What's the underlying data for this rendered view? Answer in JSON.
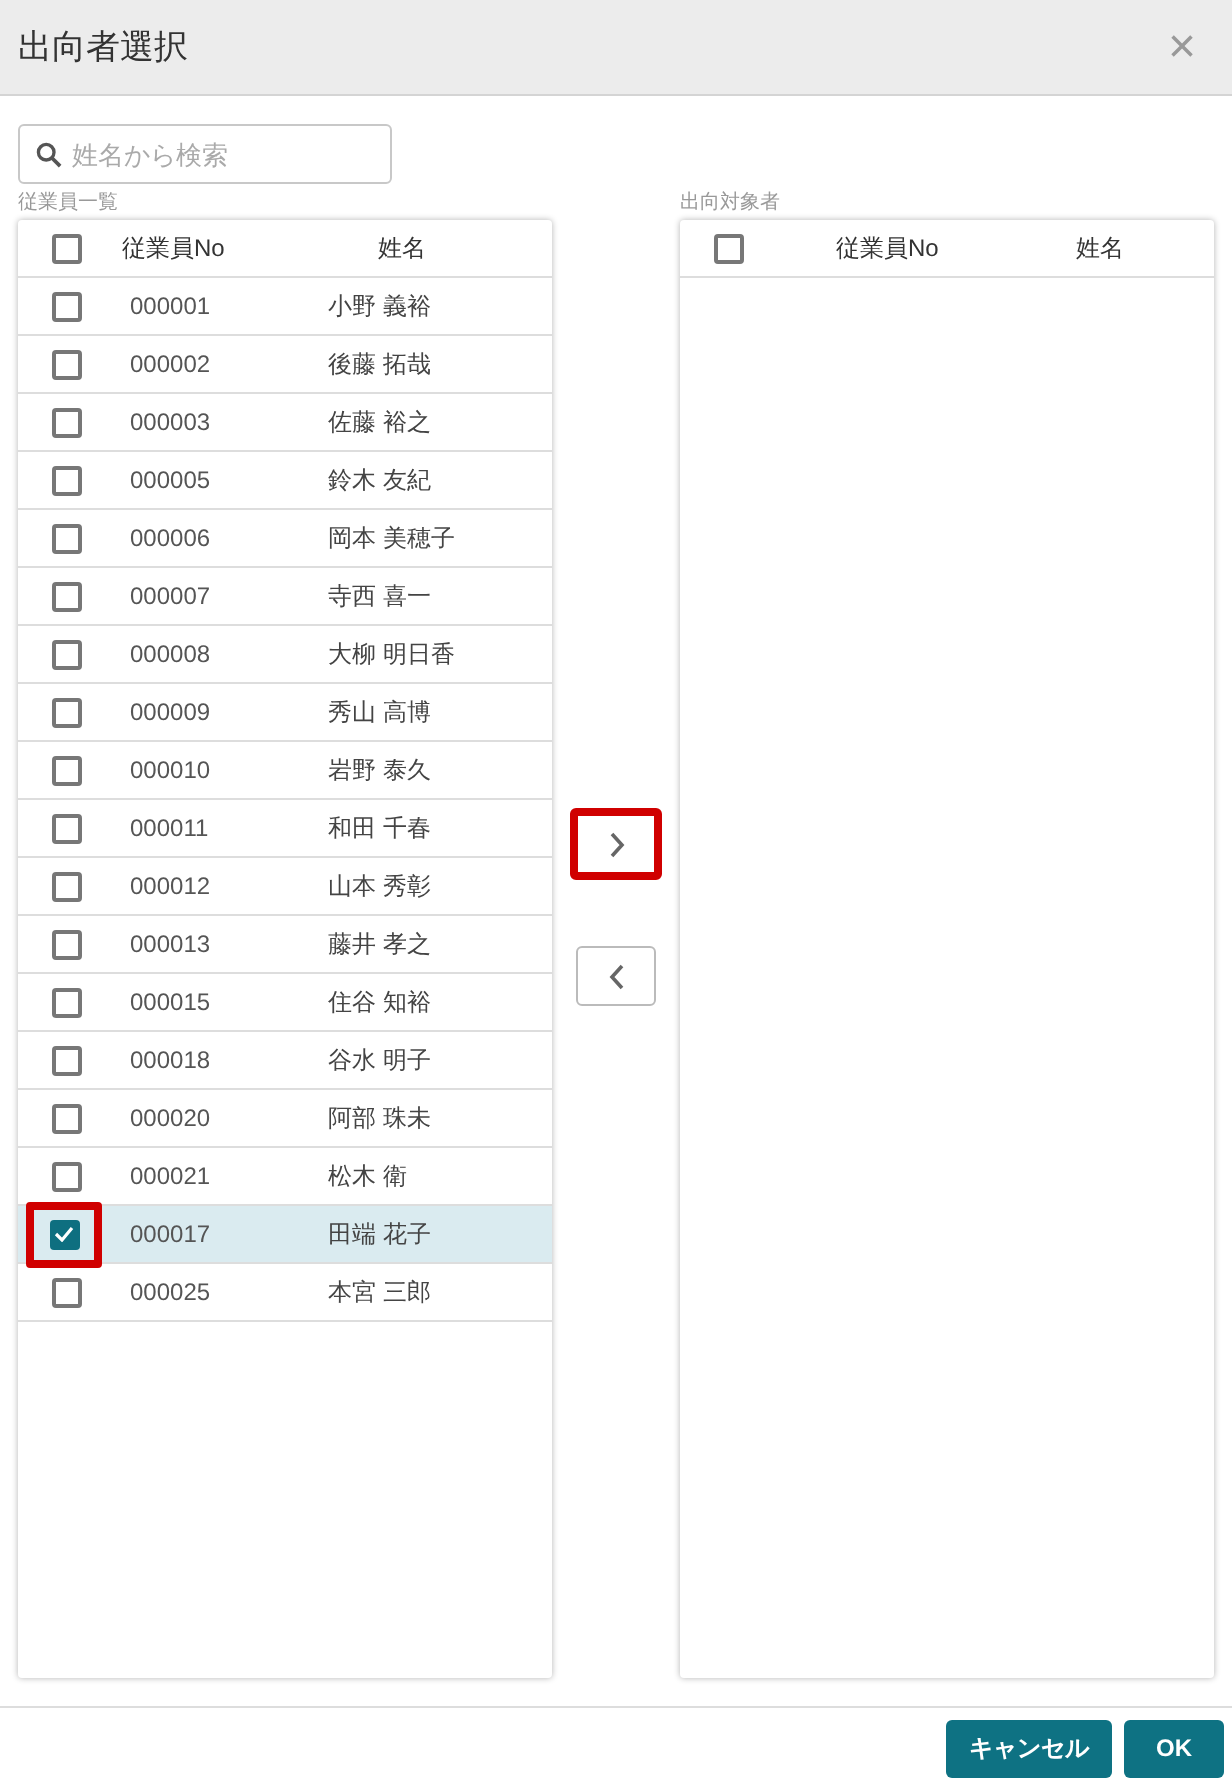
{
  "dialog": {
    "title": "出向者選択",
    "close": "×"
  },
  "search": {
    "placeholder": "姓名から検索"
  },
  "employee_list": {
    "label": "従業員一覧",
    "columns": [
      "従業員No",
      "姓名"
    ],
    "header_checked": false,
    "rows": [
      {
        "no": "000001",
        "name": "小野 義裕",
        "selected": false,
        "highlighted": false
      },
      {
        "no": "000002",
        "name": "後藤 拓哉",
        "selected": false,
        "highlighted": false
      },
      {
        "no": "000003",
        "name": "佐藤 裕之",
        "selected": false,
        "highlighted": false
      },
      {
        "no": "000005",
        "name": "鈴木 友紀",
        "selected": false,
        "highlighted": false
      },
      {
        "no": "000006",
        "name": "岡本 美穂子",
        "selected": false,
        "highlighted": false
      },
      {
        "no": "000007",
        "name": "寺西 喜一",
        "selected": false,
        "highlighted": false
      },
      {
        "no": "000008",
        "name": "大柳 明日香",
        "selected": false,
        "highlighted": false
      },
      {
        "no": "000009",
        "name": "秀山 高博",
        "selected": false,
        "highlighted": false
      },
      {
        "no": "000010",
        "name": "岩野 泰久",
        "selected": false,
        "highlighted": false
      },
      {
        "no": "000011",
        "name": "和田 千春",
        "selected": false,
        "highlighted": false
      },
      {
        "no": "000012",
        "name": "山本 秀彰",
        "selected": false,
        "highlighted": false
      },
      {
        "no": "000013",
        "name": "藤井 孝之",
        "selected": false,
        "highlighted": false
      },
      {
        "no": "000015",
        "name": "住谷 知裕",
        "selected": false,
        "highlighted": false
      },
      {
        "no": "000018",
        "name": "谷水 明子",
        "selected": false,
        "highlighted": false
      },
      {
        "no": "000020",
        "name": "阿部 珠未",
        "selected": false,
        "highlighted": false
      },
      {
        "no": "000021",
        "name": "松木 衛",
        "selected": false,
        "highlighted": false
      },
      {
        "no": "000017",
        "name": "田端 花子",
        "selected": true,
        "highlighted": true
      },
      {
        "no": "000025",
        "name": "本宮 三郎",
        "selected": false,
        "highlighted": false
      }
    ]
  },
  "transfer_buttons": [
    {
      "kind": "add",
      "highlighted": true
    },
    {
      "kind": "remove",
      "highlighted": false
    }
  ],
  "target_list": {
    "label": "出向対象者",
    "columns": [
      "従業員No",
      "姓名"
    ],
    "header_checked": false
  },
  "buttons": [
    "キャンセル",
    "OK"
  ]
}
